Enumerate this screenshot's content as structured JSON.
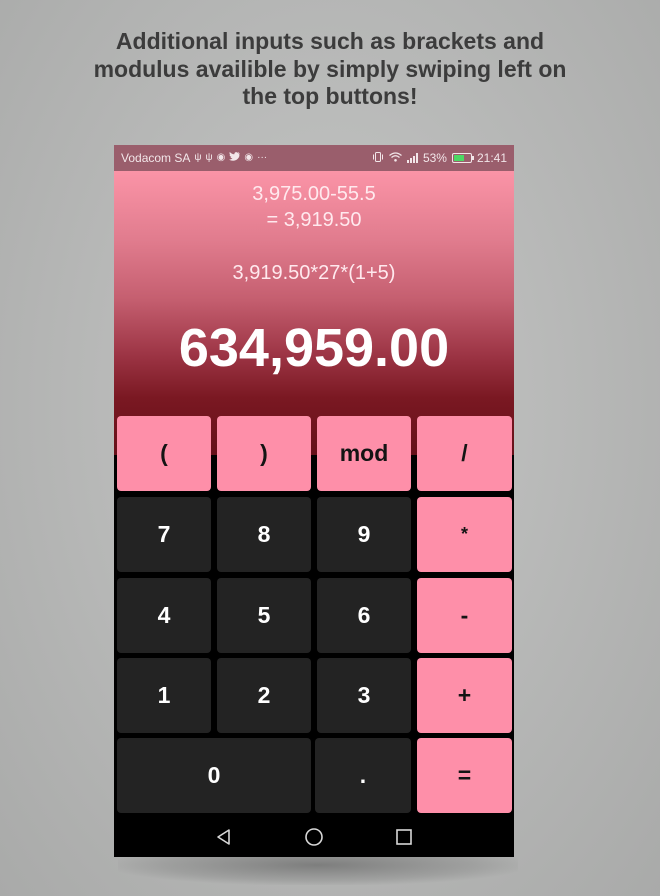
{
  "caption": {
    "line1": "Additional inputs such as brackets and",
    "line2": "modulus availible by simply swiping left on",
    "line3": "the top buttons!"
  },
  "status_bar": {
    "carrier": "Vodacom SA",
    "battery": "53%",
    "time": "21:41",
    "left_icons": [
      "usb-icon",
      "usb-icon",
      "chrome-icon",
      "twitter-icon",
      "shield-icon",
      "more-dots-icon"
    ],
    "right_icons": [
      "vibrate-icon",
      "wifi-icon",
      "signal-icon",
      "battery-icon"
    ]
  },
  "display": {
    "history_expression": "3,975.00-55.5",
    "history_result": "= 3,919.50",
    "current_expression": "3,919.50*27*(1+5)",
    "result": "634,959.00"
  },
  "keypad": {
    "rows": [
      [
        {
          "label": "(",
          "style": "pink"
        },
        {
          "label": ")",
          "style": "pink"
        },
        {
          "label": "mod",
          "style": "pink"
        },
        {
          "label": "/",
          "style": "pink"
        }
      ],
      [
        {
          "label": "7",
          "style": "dark"
        },
        {
          "label": "8",
          "style": "dark"
        },
        {
          "label": "9",
          "style": "dark"
        },
        {
          "label": "*",
          "style": "pink"
        }
      ],
      [
        {
          "label": "4",
          "style": "dark"
        },
        {
          "label": "5",
          "style": "dark"
        },
        {
          "label": "6",
          "style": "dark"
        },
        {
          "label": "-",
          "style": "pink"
        }
      ],
      [
        {
          "label": "1",
          "style": "dark"
        },
        {
          "label": "2",
          "style": "dark"
        },
        {
          "label": "3",
          "style": "dark"
        },
        {
          "label": "+",
          "style": "pink"
        }
      ],
      [
        {
          "label": "0",
          "style": "dark"
        },
        {
          "label": ".",
          "style": "dark"
        },
        {
          "label": "=",
          "style": "pink"
        }
      ]
    ]
  },
  "nav_bar": {
    "icons": [
      "back-icon",
      "home-icon",
      "recents-icon"
    ]
  },
  "colors": {
    "accent_pink": "#fe8fa9",
    "dark_button": "#232323",
    "status_bar": "#9a5e6c"
  }
}
